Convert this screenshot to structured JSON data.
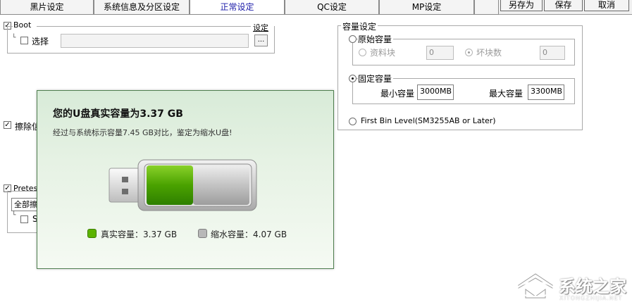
{
  "tabs": [
    {
      "label": "黑片设定",
      "active": false
    },
    {
      "label": "系统信息及分区设定",
      "active": false
    },
    {
      "label": "正常设定",
      "active": true
    },
    {
      "label": "QC设定",
      "active": false
    },
    {
      "label": "MP设定",
      "active": false
    }
  ],
  "toolbar": {
    "save_as": "另存为",
    "save": "保存",
    "cancel": "取消"
  },
  "boot": {
    "label": "Boot",
    "checked": true,
    "select_label": "选择",
    "settings_label": "设定",
    "browse_label": "...",
    "path_value": ""
  },
  "erase": {
    "label_partial": "擦除信"
  },
  "pretest": {
    "label_partial": "Pretest",
    "dropdown_partial": "全部擦",
    "sub_check_partial": "S"
  },
  "capacity": {
    "group_title": "容量设定",
    "original": {
      "label": "原始容量",
      "data_block_label": "资料块",
      "data_block_value": "0",
      "bad_block_label": "坏块数",
      "bad_block_value": "0"
    },
    "fixed": {
      "label": "固定容量",
      "min_label": "最小容量",
      "min_value": "3000MB",
      "max_label": "最大容量",
      "max_value": "3300MB"
    },
    "first_bin_label": "First Bin Level(SM3255AB or Later)",
    "selected": "fixed"
  },
  "dialog": {
    "title": "您的U盘真实容量为3.37 GB",
    "subtitle": "经过与系统标示容量7.45 GB对比，鉴定为缩水U盘!",
    "usb_real_fraction": 0.452,
    "real_label": "真实容量：3.37 GB",
    "shrunk_label": "缩水容量：4.07 GB",
    "real_color": "#5cb300",
    "shrunk_color": "#b8b8b8"
  },
  "watermark": {
    "text": "系统之家",
    "url": "XITONGZHIJIA.NET"
  }
}
